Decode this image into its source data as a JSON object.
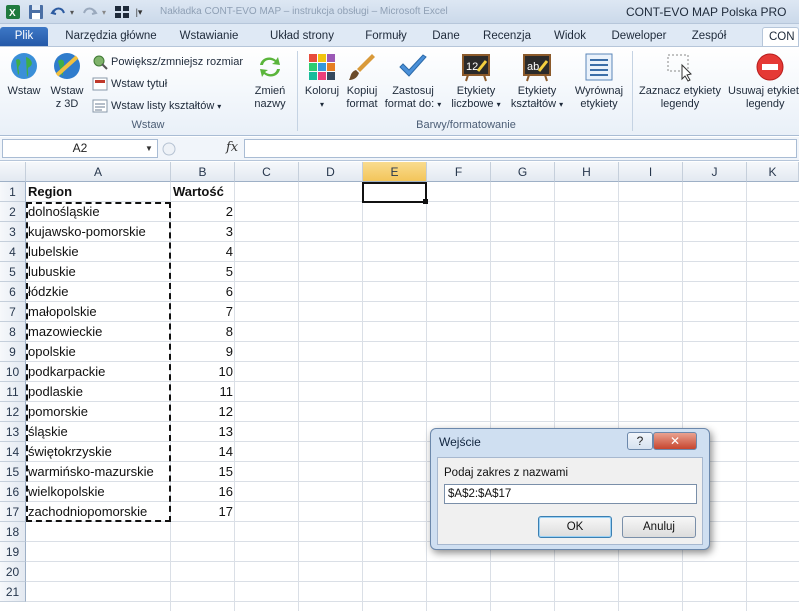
{
  "window": {
    "title": "CONT-EVO MAP Polska PRO",
    "title_dim": "Nakładka CONT-EVO MAP – instrukcja obsługi – Microsoft Excel"
  },
  "tabs": [
    {
      "label": "Plik"
    },
    {
      "label": "Narzędzia główne"
    },
    {
      "label": "Wstawianie"
    },
    {
      "label": "Układ strony"
    },
    {
      "label": "Formuły"
    },
    {
      "label": "Dane"
    },
    {
      "label": "Recenzja"
    },
    {
      "label": "Widok"
    },
    {
      "label": "Deweloper"
    },
    {
      "label": "Zespół"
    },
    {
      "label": "CON"
    }
  ],
  "ribbon": {
    "insert_group": {
      "label": "Wstaw",
      "wstaw": "Wstaw",
      "wstaw3d_1": "Wstaw",
      "wstaw3d_2": "z 3D",
      "zoom": "Powiększ/zmniejsz rozmiar",
      "title": "Wstaw tytuł",
      "shapelist": "Wstaw listy kształtów",
      "rename_1": "Zmień",
      "rename_2": "nazwy"
    },
    "format_group": {
      "label": "Barwy/formatowanie",
      "color": "Koloruj",
      "copy_1": "Kopiuj",
      "copy_2": "format",
      "apply_1": "Zastosuj",
      "apply_2": "format do:",
      "numlabels_1": "Etykiety",
      "numlabels_2": "liczbowe",
      "shapelabels_1": "Etykiety",
      "shapelabels_2": "kształtów",
      "align_1": "Wyrównaj",
      "align_2": "etykiety",
      "select_1": "Zaznacz etykiety",
      "select_2": "legendy",
      "remove_1": "Usuwaj etykiety",
      "remove_2": "legendy"
    },
    "icons": {
      "globe": "globe-icon",
      "globe3d": "globe-3d-icon",
      "zoom": "zoom-icon",
      "title": "title-icon",
      "list": "list-icon",
      "refresh": "refresh-icon",
      "palette": "palette-icon",
      "brush": "brush-icon",
      "check": "check-icon",
      "board12": "label-number-icon",
      "boardab": "label-shape-icon",
      "align": "align-icon",
      "select": "select-icon",
      "remove": "remove-icon"
    }
  },
  "formula_bar": {
    "name_box": "A2",
    "fx": "fx",
    "value": ""
  },
  "columns": [
    "A",
    "B",
    "C",
    "D",
    "E",
    "F",
    "G",
    "H",
    "I",
    "J",
    "K"
  ],
  "rows": [
    "1",
    "2",
    "3",
    "4",
    "5",
    "6",
    "7",
    "8",
    "9",
    "10",
    "11",
    "12",
    "13",
    "14",
    "15",
    "16",
    "17",
    "18",
    "19",
    "20",
    "21"
  ],
  "sheet": {
    "header_region": "Region",
    "header_value": "Wartość",
    "data": [
      {
        "region": "dolnośląskie",
        "value": "2"
      },
      {
        "region": "kujawsko-pomorskie",
        "value": "3"
      },
      {
        "region": "lubelskie",
        "value": "4"
      },
      {
        "region": "lubuskie",
        "value": "5"
      },
      {
        "region": "łódzkie",
        "value": "6"
      },
      {
        "region": "małopolskie",
        "value": "7"
      },
      {
        "region": "mazowieckie",
        "value": "8"
      },
      {
        "region": "opolskie",
        "value": "9"
      },
      {
        "region": "podkarpackie",
        "value": "10"
      },
      {
        "region": "podlaskie",
        "value": "11"
      },
      {
        "region": "pomorskie",
        "value": "12"
      },
      {
        "region": "śląskie",
        "value": "13"
      },
      {
        "region": "świętokrzyskie",
        "value": "14"
      },
      {
        "region": "warmińsko-mazurskie",
        "value": "15"
      },
      {
        "region": "wielkopolskie",
        "value": "16"
      },
      {
        "region": "zachodniopomorskie",
        "value": "17"
      }
    ]
  },
  "dialog": {
    "title": "Wejście",
    "help": "?",
    "close": "✕",
    "prompt": "Podaj zakres z nazwami",
    "input_value": "$A$2:$A$17",
    "ok": "OK",
    "cancel": "Anuluj"
  }
}
